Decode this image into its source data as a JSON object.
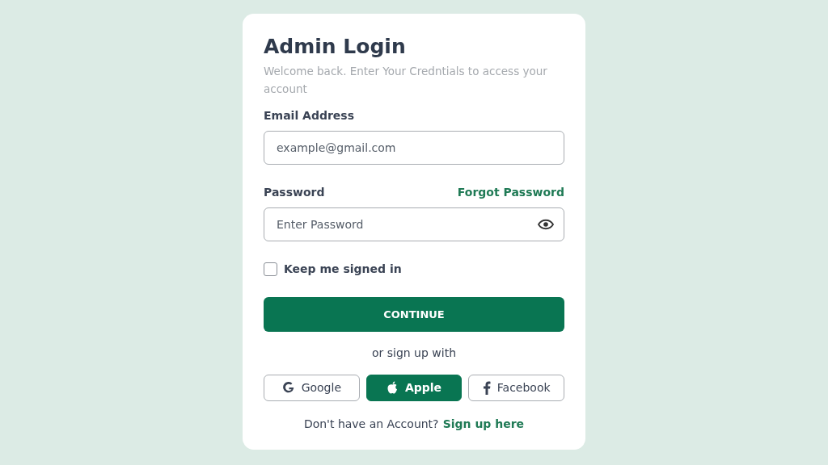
{
  "title": "Admin Login",
  "subtitle": "Welcome back. Enter Your Credntials to access your account",
  "email": {
    "label": "Email Address",
    "placeholder": "example@gmail.com"
  },
  "password": {
    "label": "Password",
    "forgot": "Forgot Password",
    "placeholder": "Enter Password"
  },
  "remember": {
    "label": "Keep me signed in",
    "checked": false
  },
  "submit": "CONTINUE",
  "divider_text": "or sign up with",
  "social": [
    {
      "kind": "google",
      "label": "Google",
      "selected": false
    },
    {
      "kind": "apple",
      "label": "Apple",
      "selected": true
    },
    {
      "kind": "facebook",
      "label": "Facebook",
      "selected": false
    }
  ],
  "footer": {
    "text": "Don't have an Account?",
    "link": "Sign up here"
  }
}
